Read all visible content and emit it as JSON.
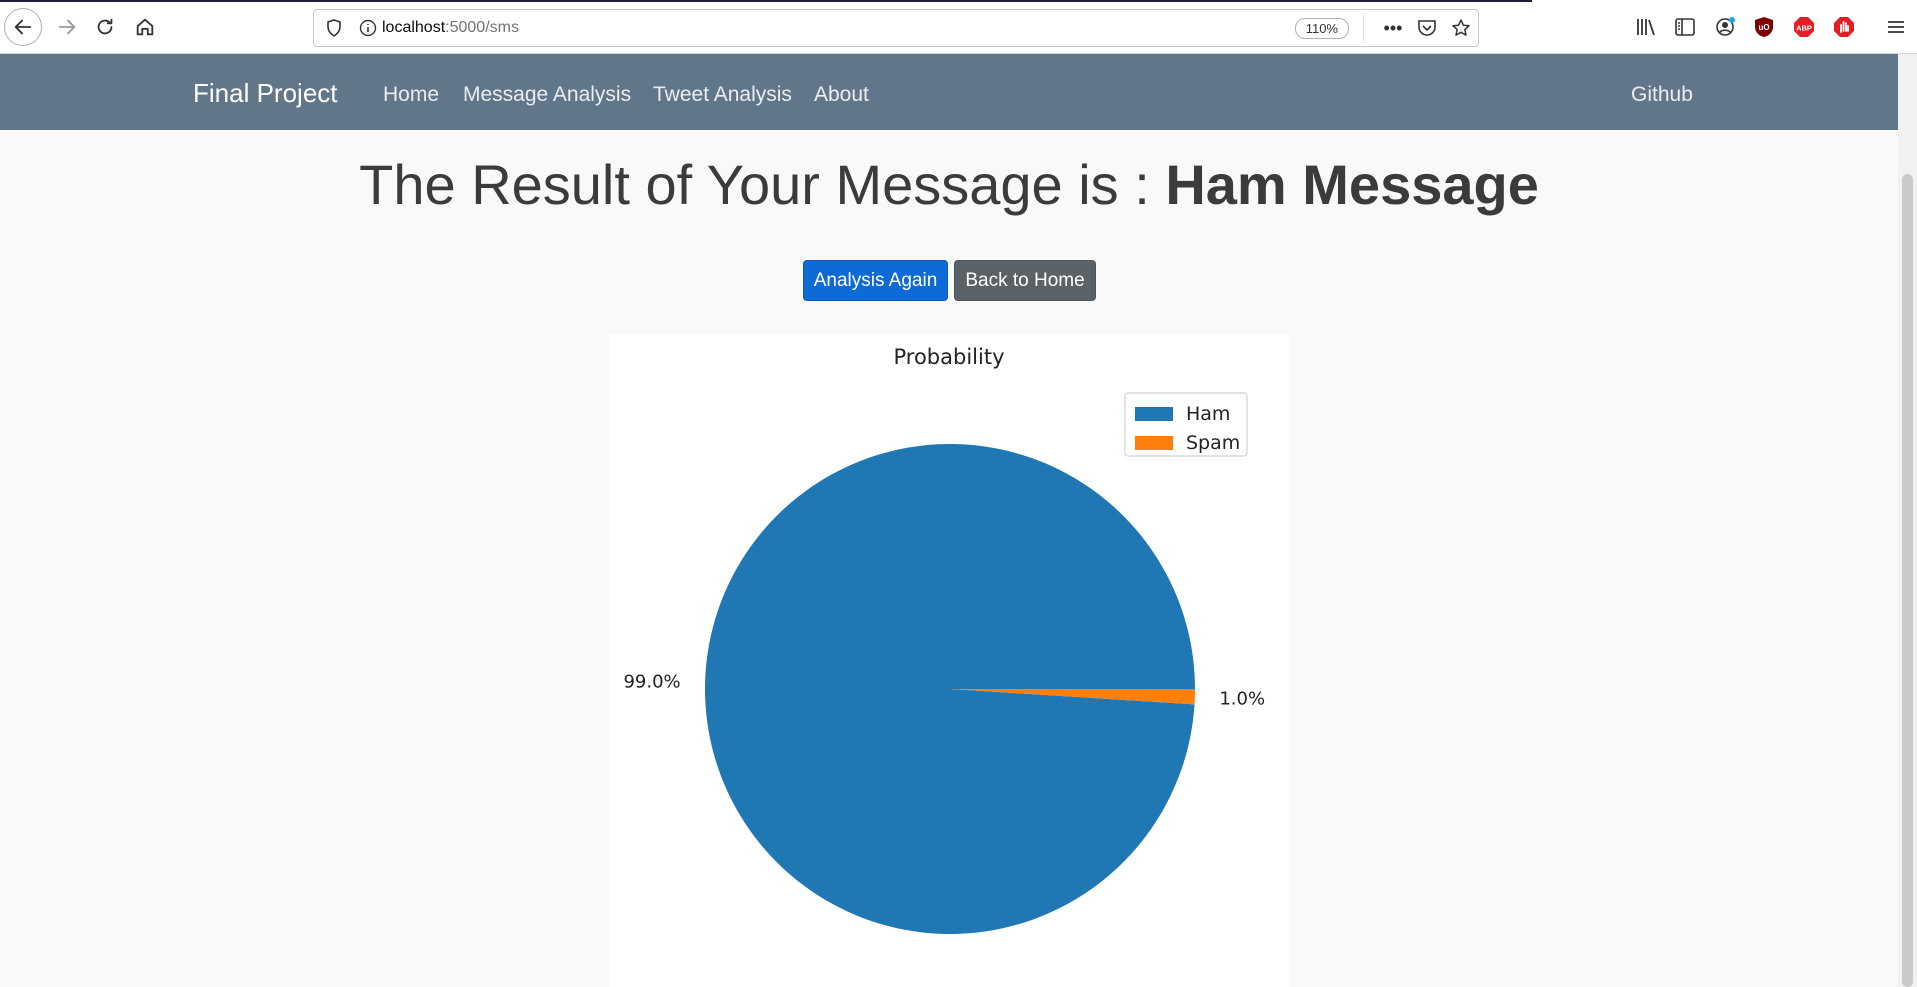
{
  "browser": {
    "url_host": "localhost",
    "url_path": ":5000/sms",
    "zoom": "110%",
    "more": "•••"
  },
  "navbar": {
    "brand": "Final Project",
    "links": [
      "Home",
      "Message Analysis",
      "Tweet Analysis",
      "About"
    ],
    "right_link": "Github"
  },
  "result": {
    "prefix": "The Result of Your Message is : ",
    "value": "Ham Message"
  },
  "buttons": {
    "analysis_again": "Analysis Again",
    "back_home": "Back to Home"
  },
  "colors": {
    "ham": "#1f77b4",
    "spam": "#ff7f0e",
    "navbar": "#617789"
  },
  "chart_data": {
    "type": "pie",
    "title": "Probability",
    "categories": [
      "Ham",
      "Spam"
    ],
    "values": [
      99.0,
      1.0
    ],
    "labels": [
      "99.0%",
      "1.0%"
    ],
    "legend": [
      "Ham",
      "Spam"
    ],
    "legend_position": "top-right",
    "colors": [
      "#1f77b4",
      "#ff7f0e"
    ]
  }
}
